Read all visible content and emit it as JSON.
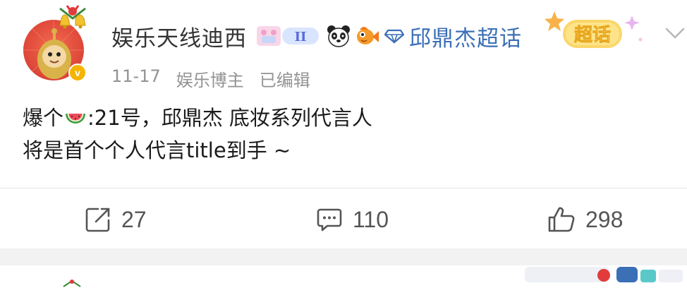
{
  "post": {
    "username": "娱乐天线迪西",
    "topic_label": "邱鼎杰超话",
    "chaohua_badge": "超话",
    "badge_text": "II",
    "verified_mark": "v",
    "meta": {
      "date": "11-17",
      "author_type": "娱乐博主",
      "edited": "已编辑"
    },
    "content": {
      "line1_before": "爆个",
      "line1_emoji": "watermelon-icon",
      "line1_after": ":21号，邱鼎杰  底妆系列代言人",
      "line2": "将是首个个人代言title到手 ~"
    },
    "actions": {
      "repost_count": "27",
      "comment_count": "110",
      "like_count": "298"
    },
    "icons": [
      "avatar",
      "bell-decoration-icon",
      "verified-icon",
      "badge-icon",
      "panda-icon",
      "fish-icon",
      "diamond-icon",
      "chaohua-badge-icon",
      "chevron-down-icon",
      "repost-icon",
      "comment-icon",
      "like-icon"
    ]
  },
  "colors": {
    "link": "#3b6fb6",
    "meta": "#939393",
    "text": "#1a1a1a",
    "verified": "#f5b400",
    "separator": "#f2f2f2"
  }
}
